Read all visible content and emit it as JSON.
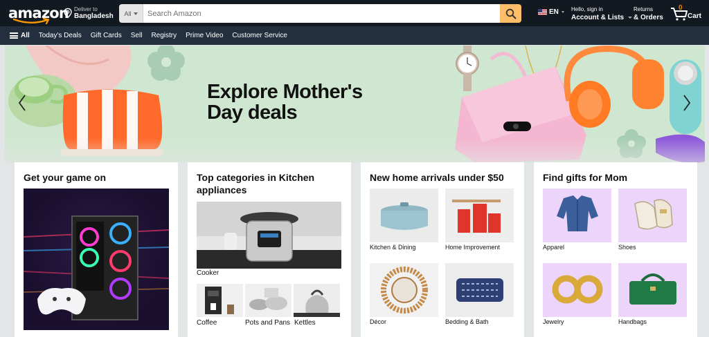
{
  "header": {
    "logo_text": "amazon",
    "deliver_line1": "Deliver to",
    "deliver_line2": "Bangladesh",
    "search": {
      "category": "All",
      "placeholder": "Search Amazon"
    },
    "language": "EN",
    "account_line1": "Hello, sign in",
    "account_line2": "Account & Lists",
    "orders_line1": "Returns",
    "orders_line2": "& Orders",
    "cart_count": "0",
    "cart_label": "Cart"
  },
  "subnav": {
    "all_label": "All",
    "links": [
      "Today's Deals",
      "Gift Cards",
      "Sell",
      "Registry",
      "Prime Video",
      "Customer Service"
    ]
  },
  "hero": {
    "title_line1": "Explore Mother's",
    "title_line2": "Day deals"
  },
  "cards": [
    {
      "title": "Get your game on"
    },
    {
      "title": "Top categories in Kitchen appliances",
      "main_label": "Cooker",
      "items": [
        "Coffee",
        "Pots and Pans",
        "Kettles"
      ]
    },
    {
      "title": "New home arrivals under $50",
      "items": [
        "Kitchen & Dining",
        "Home Improvement",
        "Décor",
        "Bedding & Bath"
      ]
    },
    {
      "title": "Find gifts for Mom",
      "items": [
        "Apparel",
        "Shoes",
        "Jewelry",
        "Handbags"
      ]
    }
  ],
  "colors": {
    "nav_top": "#131921",
    "nav_sub": "#232f3e",
    "search_button": "#febd69",
    "cart_count": "#f08804",
    "hero_bg": "#cfe7d0",
    "gift_tile_bg": "#ecd4fb"
  }
}
